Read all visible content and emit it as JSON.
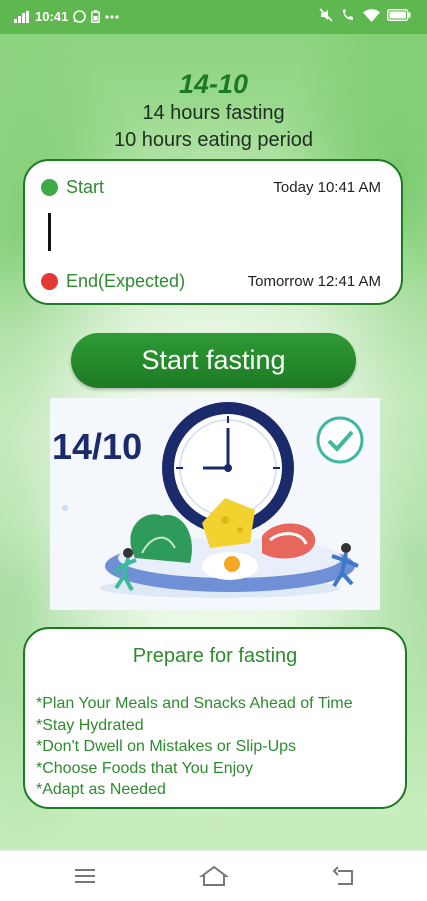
{
  "status_bar": {
    "time": "10:41"
  },
  "plan": {
    "title": "14-10",
    "fasting_line": "14 hours fasting",
    "eating_line": "10 hours eating period"
  },
  "schedule": {
    "start_label": "Start",
    "start_time": "Today 10:41 AM",
    "end_label": "End(Expected)",
    "end_time": "Tomorrow 12:41 AM"
  },
  "actions": {
    "start_fasting_label": "Start fasting"
  },
  "illustration": {
    "label": "14/10"
  },
  "prepare": {
    "title": "Prepare for fasting",
    "tips": [
      "*Plan Your Meals and Snacks Ahead of Time",
      "*Stay Hydrated",
      "*Don't Dwell on Mistakes or Slip-Ups",
      "*Choose Foods that You Enjoy",
      "*Adapt as Needed"
    ]
  },
  "colors": {
    "brand_green": "#1e7a22",
    "start_dot": "#3cab45",
    "end_dot": "#e53935",
    "status_bar": "#5fb84f"
  },
  "icons": {
    "status_left": [
      "signal-icon",
      "whatsapp-icon",
      "battery-saver-icon",
      "more-icon"
    ],
    "status_right": [
      "mute-icon",
      "wifi-call-icon",
      "wifi-icon",
      "battery-icon"
    ],
    "nav": [
      "menu-icon",
      "home-icon",
      "back-icon"
    ]
  }
}
